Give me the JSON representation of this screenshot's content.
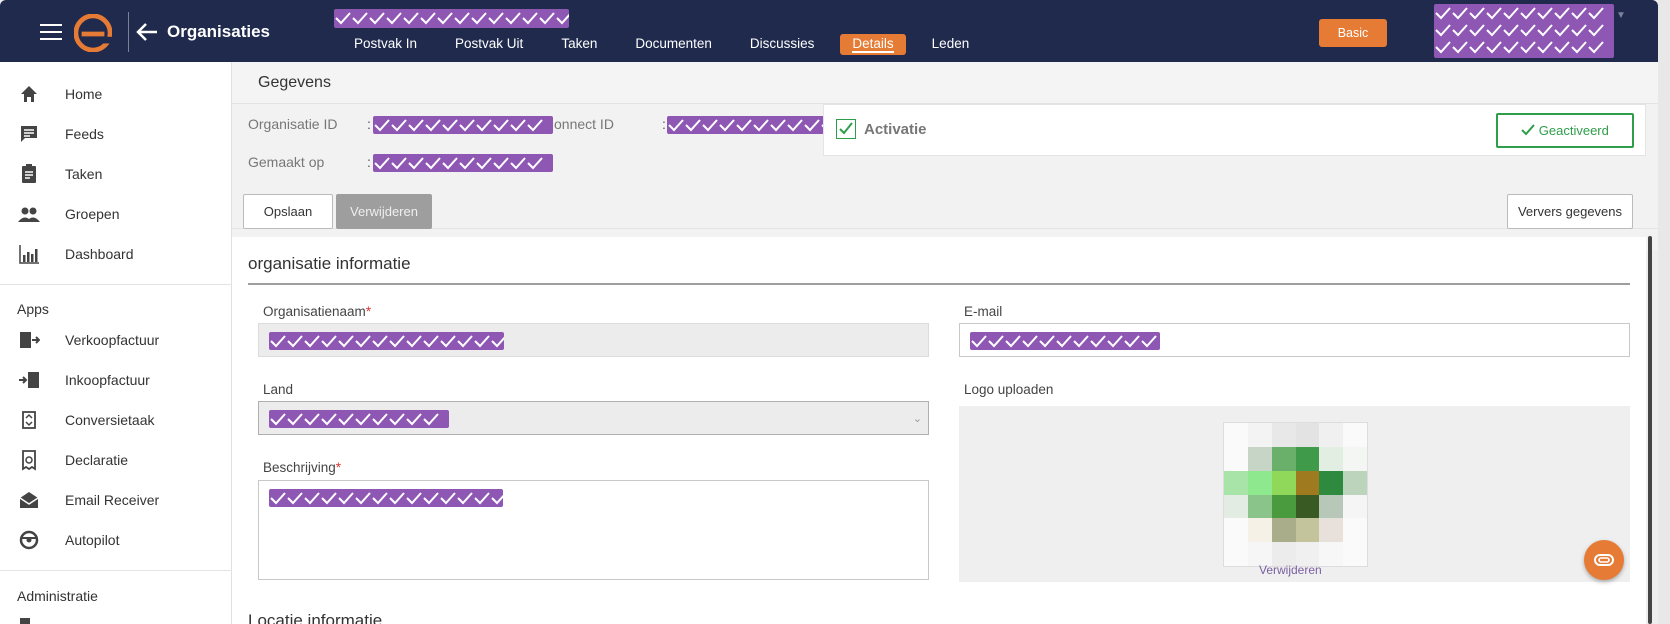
{
  "header": {
    "title": "Organisaties",
    "nav": [
      "Postvak In",
      "Postvak Uit",
      "Taken",
      "Documenten",
      "Discussies",
      "Details",
      "Leden"
    ],
    "active_nav": "Details",
    "basic_label": "Basic"
  },
  "sidebar": {
    "items": [
      {
        "label": "Home",
        "icon": "home-icon"
      },
      {
        "label": "Feeds",
        "icon": "feeds-icon"
      },
      {
        "label": "Taken",
        "icon": "clipboard-icon"
      },
      {
        "label": "Groepen",
        "icon": "people-icon"
      },
      {
        "label": "Dashboard",
        "icon": "chart-icon"
      }
    ],
    "apps_label": "Apps",
    "apps": [
      {
        "label": "Verkoopfactuur",
        "icon": "invoice-out-icon"
      },
      {
        "label": "Inkoopfactuur",
        "icon": "invoice-in-icon"
      },
      {
        "label": "Conversietaak",
        "icon": "convert-icon"
      },
      {
        "label": "Declaratie",
        "icon": "receipt-icon"
      },
      {
        "label": "Email Receiver",
        "icon": "email-icon"
      },
      {
        "label": "Autopilot",
        "icon": "autopilot-icon"
      }
    ],
    "admin_label": "Administratie"
  },
  "gegevens": {
    "title": "Gegevens",
    "org_id_label": "Organisatie ID",
    "connect_id_label": "onnect ID",
    "created_label": "Gemaakt op",
    "colon": ":",
    "activatie_label": "Activatie",
    "geactiveerd_label": "Geactiveerd",
    "opslaan_label": "Opslaan",
    "verwijderen_label": "Verwijderen",
    "ververs_label": "Ververs gegevens"
  },
  "form": {
    "section_title": "organisatie informatie",
    "org_name_label": "Organisatienaam",
    "required_mark": "*",
    "email_label": "E-mail",
    "land_label": "Land",
    "logo_label": "Logo uploaden",
    "beschrijving_label": "Beschrijving",
    "logo_remove_label": "Verwijderen",
    "next_section_title": "Locatie informatie"
  },
  "colors": {
    "topbar": "#1f2a4d",
    "accent": "#e57b35",
    "success": "#2f9e4a",
    "mask": "#8e57b4"
  }
}
